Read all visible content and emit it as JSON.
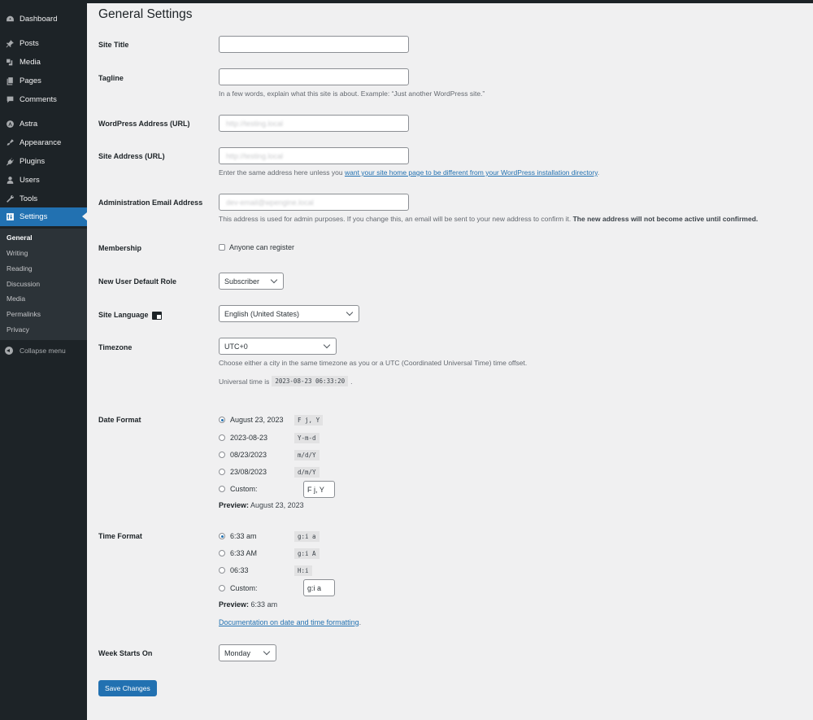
{
  "sidebar": {
    "items": [
      {
        "label": "Dashboard",
        "icon": "dashboard-icon"
      },
      {
        "label": "Posts",
        "icon": "pin-icon"
      },
      {
        "label": "Media",
        "icon": "media-icon"
      },
      {
        "label": "Pages",
        "icon": "pages-icon"
      },
      {
        "label": "Comments",
        "icon": "comment-icon"
      },
      {
        "label": "Astra",
        "icon": "astra-icon"
      },
      {
        "label": "Appearance",
        "icon": "brush-icon"
      },
      {
        "label": "Plugins",
        "icon": "plug-icon"
      },
      {
        "label": "Users",
        "icon": "user-icon"
      },
      {
        "label": "Tools",
        "icon": "wrench-icon"
      },
      {
        "label": "Settings",
        "icon": "settings-icon"
      }
    ],
    "submenu": [
      "General",
      "Writing",
      "Reading",
      "Discussion",
      "Media",
      "Permalinks",
      "Privacy"
    ],
    "collapse_label": "Collapse menu"
  },
  "page": {
    "title": "General Settings"
  },
  "form": {
    "site_title": {
      "label": "Site Title",
      "value": ""
    },
    "tagline": {
      "label": "Tagline",
      "value": "",
      "description": "In a few words, explain what this site is about. Example: “Just another WordPress site.”"
    },
    "wp_address": {
      "label": "WordPress Address (URL)",
      "value": "http://testing.local"
    },
    "site_address": {
      "label": "Site Address (URL)",
      "value": "http://testing.local",
      "description_prefix": "Enter the same address here unless you ",
      "description_link": "want your site home page to be different from your WordPress installation directory",
      "description_suffix": "."
    },
    "admin_email": {
      "label": "Administration Email Address",
      "value": "dev-email@wpengine.local",
      "description": "This address is used for admin purposes. If you change this, an email will be sent to your new address to confirm it. ",
      "description_bold": "The new address will not become active until confirmed."
    },
    "membership": {
      "label": "Membership",
      "checkbox_label": "Anyone can register",
      "checked": false
    },
    "default_role": {
      "label": "New User Default Role",
      "selected": "Subscriber"
    },
    "site_language": {
      "label": "Site Language",
      "selected": "English (United States)"
    },
    "timezone": {
      "label": "Timezone",
      "selected": "UTC+0",
      "description": "Choose either a city in the same timezone as you or a UTC (Coordinated Universal Time) time offset.",
      "universal_prefix": "Universal time is",
      "universal_time": "2023-08-23 06:33:20",
      "universal_suffix": "."
    },
    "date_format": {
      "label": "Date Format",
      "options": [
        {
          "label": "August 23, 2023",
          "code": "F j, Y",
          "checked": true
        },
        {
          "label": "2023-08-23",
          "code": "Y-m-d",
          "checked": false
        },
        {
          "label": "08/23/2023",
          "code": "m/d/Y",
          "checked": false
        },
        {
          "label": "23/08/2023",
          "code": "d/m/Y",
          "checked": false
        }
      ],
      "custom_label": "Custom:",
      "custom_value": "F j, Y",
      "preview_label": "Preview:",
      "preview_value": "August 23, 2023"
    },
    "time_format": {
      "label": "Time Format",
      "options": [
        {
          "label": "6:33 am",
          "code": "g:i a",
          "checked": true
        },
        {
          "label": "6:33 AM",
          "code": "g:i A",
          "checked": false
        },
        {
          "label": "06:33",
          "code": "H:i",
          "checked": false
        }
      ],
      "custom_label": "Custom:",
      "custom_value": "g:i a",
      "preview_label": "Preview:",
      "preview_value": "6:33 am",
      "doc_link": "Documentation on date and time formatting",
      "doc_suffix": "."
    },
    "week_starts": {
      "label": "Week Starts On",
      "selected": "Monday"
    },
    "save_label": "Save Changes"
  },
  "colors": {
    "accent": "#2271b1",
    "sidebar_bg": "#1d2327",
    "submenu_bg": "#2c3338",
    "page_bg": "#f0f0f1"
  }
}
